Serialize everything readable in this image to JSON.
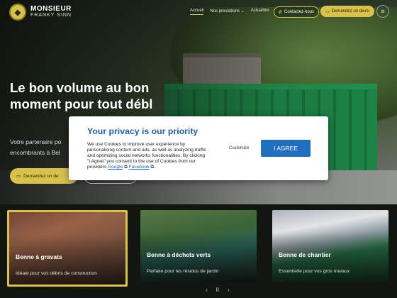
{
  "brand": {
    "line1": "MONSIEUR",
    "line2": "FRANKY SINN"
  },
  "nav": {
    "items": [
      "Accueil",
      "Nos prestations ⌄",
      "Actualités"
    ]
  },
  "header": {
    "contact_label": "Contactez-nous",
    "devis_label": "Demandez un devis"
  },
  "hero": {
    "title": "Le bon volume au bon moment pour tout débl",
    "subtitle": "Votre partenaire po encombrants à Bel",
    "cta_label": "Demandez un de"
  },
  "cards": [
    {
      "title": "Benne à gravats",
      "desc": "Idéale pour vos débris de construction"
    },
    {
      "title": "Benne à déchets verts",
      "desc": "Parfaite pour les résidus de jardin"
    },
    {
      "title": "Benne de chantier",
      "desc": "Essentielle pour vos gros travaux"
    }
  ],
  "pager": {
    "prev": "‹",
    "pause": "II",
    "next": "›"
  },
  "cookie": {
    "title": "Your privacy is our priority",
    "text": "We use Cookies to improve user experience by personalising content and ads, as well as analyzing traffic and optimizing social networks functionalities. By clicking \"I Agree\" you consent to the use of Cookies from our providers",
    "link_google": "Google",
    "link_facebook": "Facebook",
    "customize_label": "Customize",
    "agree_label": "I AGREE"
  },
  "colors": {
    "accent": "#d8c24a",
    "cookie_blue": "#1f6ec0"
  }
}
